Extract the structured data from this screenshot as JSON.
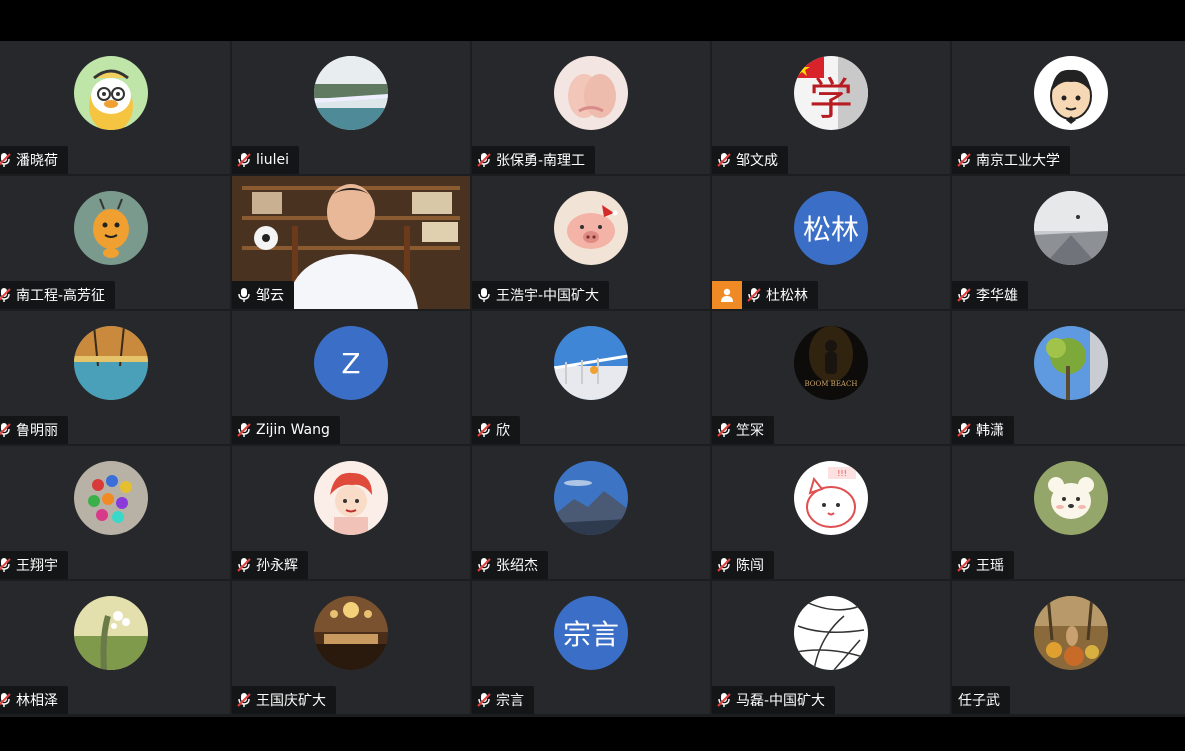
{
  "meeting": {
    "participants": [
      {
        "name": "潘晓荷",
        "muted": true,
        "avatar": "cartoon-duck-avatar"
      },
      {
        "name": "liulei",
        "muted": true,
        "avatar": "waterfall-photo-avatar"
      },
      {
        "name": "张保勇-南理工",
        "muted": true,
        "avatar": "hands-photo-avatar"
      },
      {
        "name": "邹文成",
        "muted": true,
        "avatar": "flag-xue-avatar"
      },
      {
        "name": "南京工业大学",
        "muted": true,
        "avatar": "cartoon-face-avatar"
      },
      {
        "name": "南工程-高芳征",
        "muted": true,
        "avatar": "cartoon-bee-avatar"
      },
      {
        "name": "邹云",
        "muted": false,
        "avatar": "video-feed"
      },
      {
        "name": "王浩宇-中国矿大",
        "muted": false,
        "avatar": "piglet-photo-avatar"
      },
      {
        "name": "杜松林",
        "muted": true,
        "avatar_text": "松林",
        "host": true
      },
      {
        "name": "李华雄",
        "muted": true,
        "avatar": "foggy-landscape-avatar"
      },
      {
        "name": "鲁明丽",
        "muted": true,
        "avatar": "autumn-lake-avatar"
      },
      {
        "name": "Zijin Wang",
        "muted": true,
        "avatar_text": "Z"
      },
      {
        "name": "欣",
        "muted": true,
        "avatar": "railing-sky-avatar"
      },
      {
        "name": "笁冞",
        "muted": true,
        "avatar": "boom-beach-avatar",
        "avatar_caption": "BOOM BEACH"
      },
      {
        "name": "韩潇",
        "muted": true,
        "avatar": "tree-sky-avatar"
      },
      {
        "name": "王翔宇",
        "muted": true,
        "avatar": "colored-balls-avatar"
      },
      {
        "name": "孙永辉",
        "muted": true,
        "avatar": "cartoon-redhair-avatar"
      },
      {
        "name": "张绍杰",
        "muted": true,
        "avatar": "mountain-sky-avatar"
      },
      {
        "name": "陈闯",
        "muted": true,
        "avatar": "cartoon-cat-avatar"
      },
      {
        "name": "王瑶",
        "muted": true,
        "avatar": "cartoon-bear-avatar"
      },
      {
        "name": "林相泽",
        "muted": true,
        "avatar": "flower-photo-avatar"
      },
      {
        "name": "王国庆矿大",
        "muted": true,
        "avatar": "hall-photo-avatar"
      },
      {
        "name": "宗言",
        "muted": true,
        "avatar_text": "宗言"
      },
      {
        "name": "马磊-中国矿大",
        "muted": true,
        "avatar": "line-sketch-avatar"
      },
      {
        "name": "任子武",
        "muted": false,
        "no_mic": true,
        "avatar": "autumn-leaves-avatar"
      }
    ]
  },
  "colors": {
    "tile_bg": "#26282b",
    "text_avatar_bg": "#3b6ec6",
    "host_badge": "#f08a24",
    "muted_icon": "#e04040"
  }
}
